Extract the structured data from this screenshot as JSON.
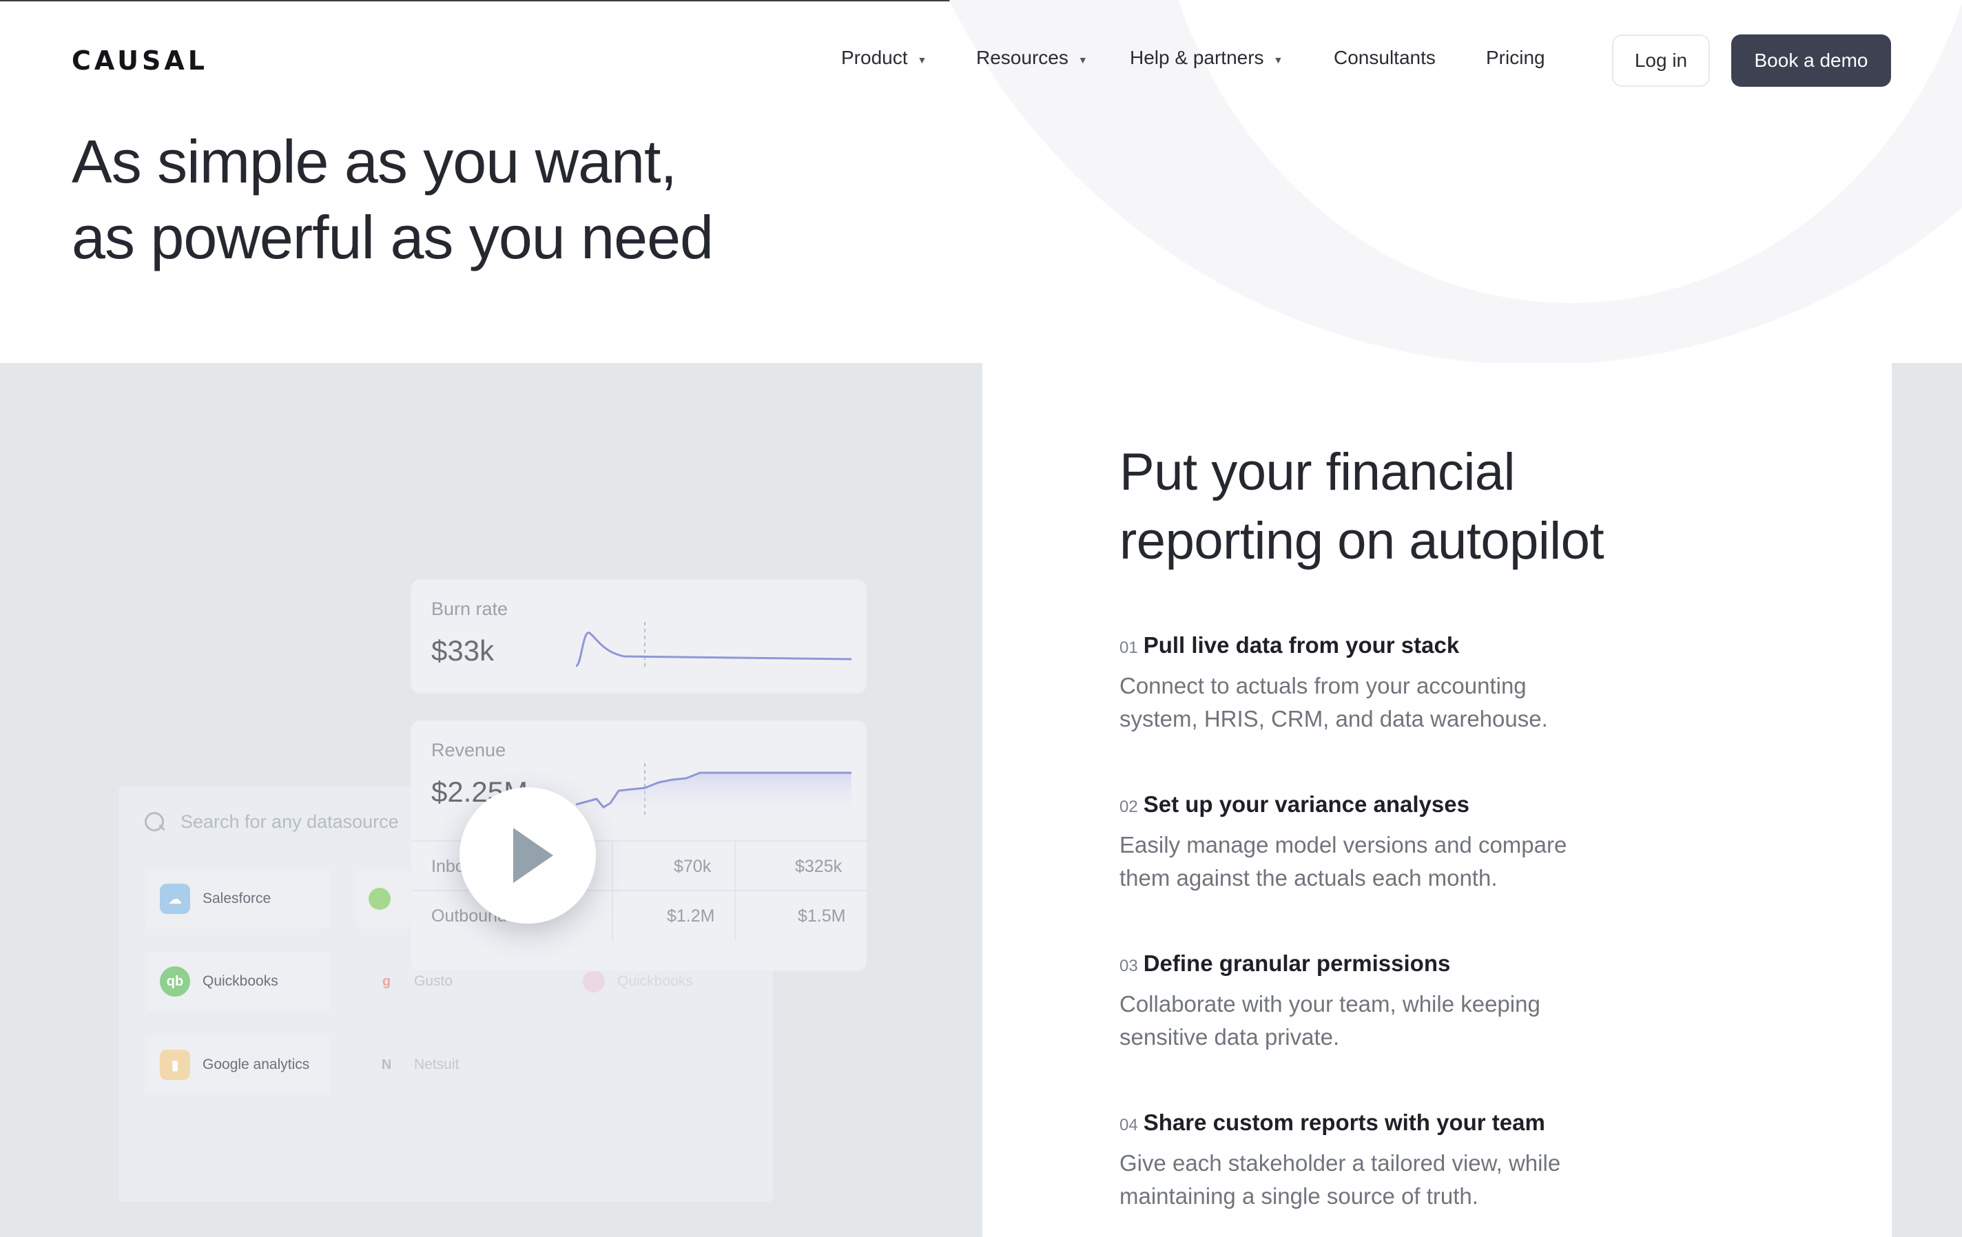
{
  "brand": {
    "logo": "CAUSAL"
  },
  "nav": {
    "items": [
      {
        "label": "Product",
        "dropdown": true
      },
      {
        "label": "Resources",
        "dropdown": true
      },
      {
        "label": "Help & partners",
        "dropdown": true
      },
      {
        "label": "Consultants",
        "dropdown": false
      },
      {
        "label": "Pricing",
        "dropdown": false
      }
    ],
    "login_label": "Log in",
    "demo_label": "Book a demo"
  },
  "hero": {
    "line1": "As simple as you want,",
    "line2": "as powerful as you need"
  },
  "mockup": {
    "search_placeholder": "Search for any datasource",
    "datasources": [
      {
        "label": "Salesforce",
        "icon": "salesforce-icon",
        "color": "#9cc3e6"
      },
      {
        "label": "Quickbooks",
        "icon": "quickbooks-icon",
        "color": "#8fcf8f"
      },
      {
        "label": "Google analytics",
        "icon": "google-analytics-icon",
        "color": "#f0c27a"
      },
      {
        "label": "Gusto",
        "icon": "gusto-icon",
        "color": "#f0b3a8"
      },
      {
        "label": "Netsuit",
        "icon": "netsuite-icon",
        "color": "#cfd3d9"
      },
      {
        "label": "Quickbooks",
        "icon": "quickbooks-icon",
        "color": "#e6cfe0"
      }
    ],
    "burn": {
      "label": "Burn rate",
      "value": "$33k"
    },
    "revenue": {
      "label": "Revenue",
      "value": "$2.25M"
    },
    "rows": [
      {
        "label": "Inbound",
        "a": "$70k",
        "b": "$325k"
      },
      {
        "label": "Outbound",
        "a": "$1.2M",
        "b": "$1.5M"
      }
    ],
    "play_icon": "play-icon"
  },
  "section": {
    "title_line1": "Put your financial",
    "title_line2": "reporting on autopilot",
    "features": [
      {
        "num": "01",
        "title": "Pull live data from your stack",
        "desc1": "Connect to actuals from your accounting",
        "desc2": "system, HRIS, CRM, and data warehouse."
      },
      {
        "num": "02",
        "title": "Set up your variance analyses",
        "desc1": "Easily manage model versions and compare",
        "desc2": "them against the actuals each month."
      },
      {
        "num": "03",
        "title": "Define granular permissions",
        "desc1": "Collaborate with your team, while keeping",
        "desc2": "sensitive data private."
      },
      {
        "num": "04",
        "title": "Share custom reports with your team",
        "desc1": "Give each stakeholder a tailored view, while",
        "desc2": "maintaining a single source of truth."
      }
    ]
  },
  "colors": {
    "demo_button": "#3d4151",
    "panel_bg": "#e4e7ea",
    "accent_line": "#8f97d8"
  }
}
